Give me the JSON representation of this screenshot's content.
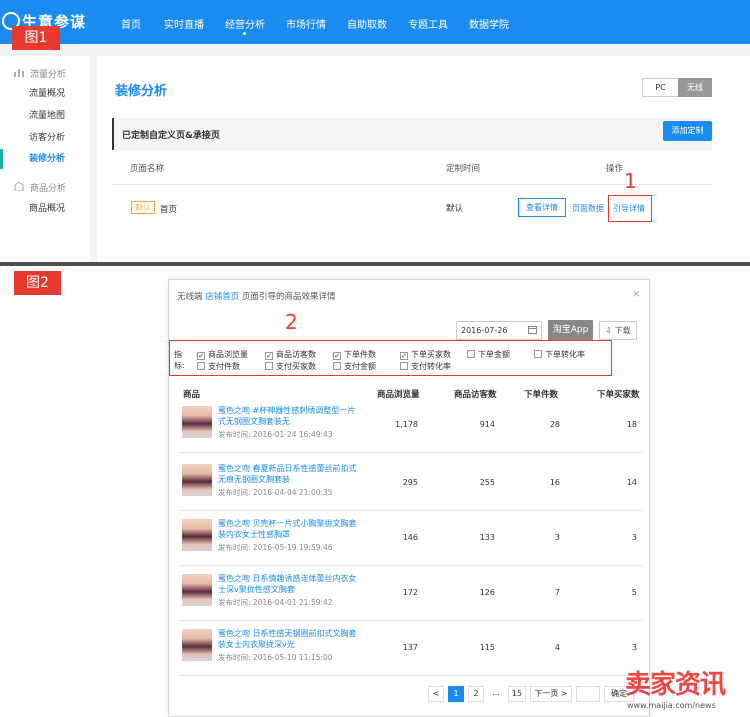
{
  "fig1": {
    "logo": "生意参谋",
    "tag": "图1",
    "nav": [
      "首页",
      "实时直播",
      "经营分析",
      "市场行情",
      "自助取数",
      "专题工具",
      "数据学院"
    ],
    "nav_active": "经营分析",
    "sidebar": {
      "group1": "流量分析",
      "items1": [
        "流量概况",
        "流量地图",
        "访客分析",
        "装修分析"
      ],
      "active": "装修分析",
      "group2": "商品分析",
      "items2": [
        "商品概况"
      ]
    },
    "title": "装修分析",
    "seg": {
      "pc": "PC",
      "wireless": "无线"
    },
    "section_title": "已定制自定义页&承接页",
    "add_custom": "添加定制",
    "columns": {
      "name": "页面名称",
      "time": "定制时间",
      "action": "操作"
    },
    "row": {
      "badge": "默认",
      "name": "首页",
      "time": "默认",
      "btn_detail": "查看详情",
      "link_data": "页面数据",
      "link_guide": "引导详情"
    },
    "marker": "1"
  },
  "fig2": {
    "tag": "图2",
    "dialog": {
      "title_prefix": "无线端",
      "title_link": "店铺首页",
      "title_suffix": "页面引导的商品效果详情",
      "close": "×",
      "date": "2016-07-26",
      "app_btn": "淘宝App",
      "download": "下载",
      "metric_label": "指标:",
      "metrics": [
        {
          "label": "商品浏览量",
          "checked": true
        },
        {
          "label": "商品访客数",
          "checked": true
        },
        {
          "label": "下单件数",
          "checked": true
        },
        {
          "label": "下单买家数",
          "checked": true
        },
        {
          "label": "下单金额",
          "checked": false
        },
        {
          "label": "下单转化率",
          "checked": false
        },
        {
          "label": "支付件数",
          "checked": false
        },
        {
          "label": "支付买家数",
          "checked": false
        },
        {
          "label": "支付金额",
          "checked": false
        },
        {
          "label": "支付转化率",
          "checked": false
        }
      ],
      "columns": [
        "商品",
        "商品浏览量",
        "商品访客数",
        "下单件数",
        "下单买家数"
      ],
      "rows": [
        {
          "name": "蜜色之吻 #杯神器性感刺绣调整型一片式无钢圈文胸套装无",
          "time_prefix": "发布时间:",
          "time": "2016-01-24 16:49:43",
          "pv": "1,178",
          "uv": "914",
          "orders": "28",
          "buyers": "18"
        },
        {
          "name": "蜜色之吻 春夏新品日系性感蕾丝前扣式无痕无钢圈文胸套装",
          "time_prefix": "发布时间:",
          "time": "2016-04-04 21:00:35",
          "pv": "295",
          "uv": "255",
          "orders": "16",
          "buyers": "14"
        },
        {
          "name": "蜜色之吻 贝壳杯一片式小胸聚拢文胸套装内衣女士性感胸罩",
          "time_prefix": "发布时间:",
          "time": "2016-05-19 19:59:46",
          "pv": "146",
          "uv": "133",
          "orders": "3",
          "buyers": "3"
        },
        {
          "name": "蜜色之吻 日系情趣诱惑连体蕾丝内衣女士深v聚拢性感文胸套",
          "time_prefix": "发布时间:",
          "time": "2016-04-01 21:59:42",
          "pv": "172",
          "uv": "126",
          "orders": "7",
          "buyers": "5"
        },
        {
          "name": "蜜色之吻 日系性感无钢圈前扣式文胸套装女士内衣聚拢深v光",
          "time_prefix": "发布时间:",
          "time": "2016-05-10 11:15:00",
          "pv": "137",
          "uv": "115",
          "orders": "4",
          "buyers": "3"
        }
      ],
      "pager": {
        "prev": "<",
        "p1": "1",
        "p2": "2",
        "ellipsis": "…",
        "last": "15",
        "next": "下一页 >",
        "confirm": "确定"
      }
    },
    "marker": "2"
  },
  "watermark": {
    "text": "卖家资讯",
    "url": "www.maijia.com/news"
  },
  "colors": {
    "brand_blue": "#1a8bf0",
    "accent_red": "#e8392e",
    "active_teal": "#12b5a4"
  }
}
